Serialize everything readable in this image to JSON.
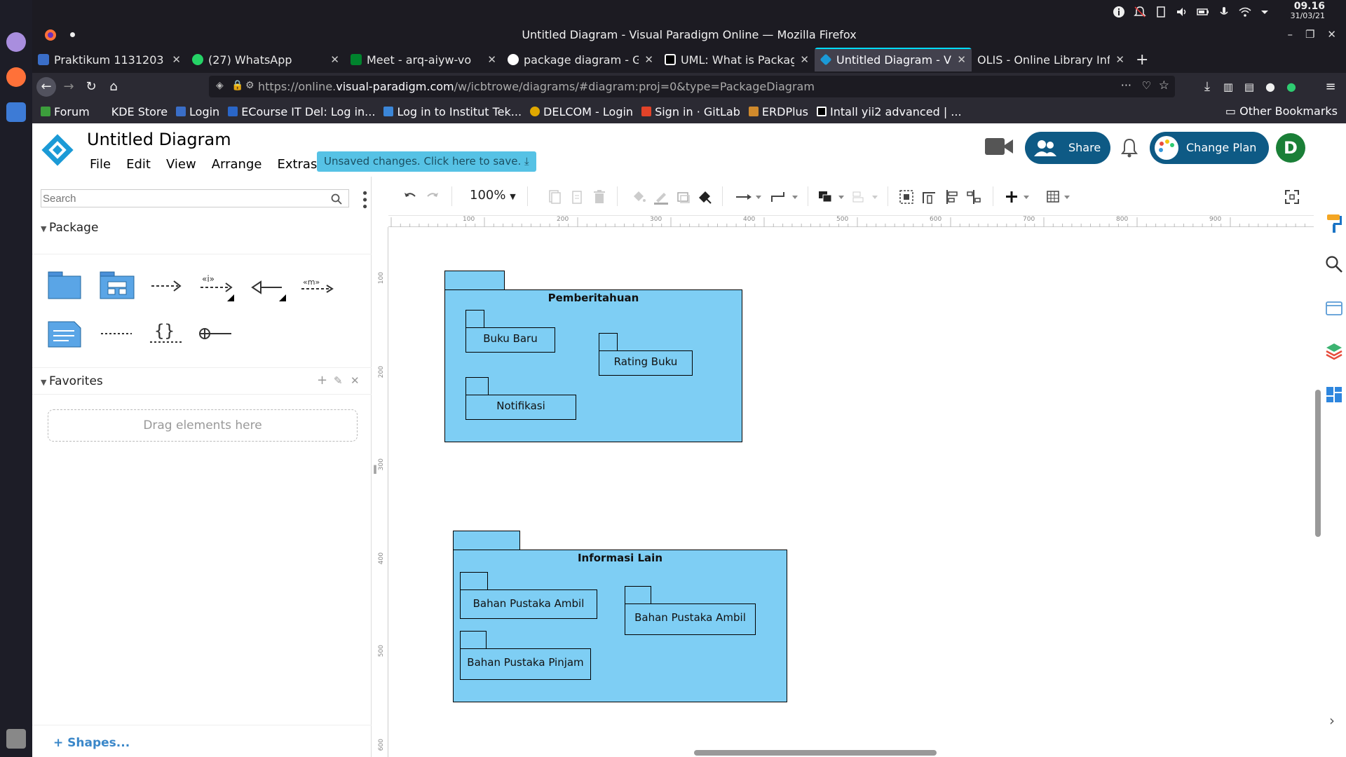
{
  "os": {
    "clock_time": "09.16",
    "clock_date": "31/03/21"
  },
  "window": {
    "title": "Untitled Diagram - Visual Paradigm Online — Mozilla Firefox"
  },
  "tabs": [
    {
      "label": "Praktikum 1131203",
      "active": false
    },
    {
      "label": "(27) WhatsApp",
      "active": false
    },
    {
      "label": "Meet - arq-aiyw-vo",
      "active": false
    },
    {
      "label": "package diagram - G",
      "active": false
    },
    {
      "label": "UML: What is Packag",
      "active": false
    },
    {
      "label": "Untitled Diagram - VP",
      "active": true
    },
    {
      "label": "OLIS - Online Library Inf",
      "active": false
    }
  ],
  "url": {
    "prefix": "https://online.",
    "domain": "visual-paradigm.com",
    "path": "/w/icbtrowe/diagrams/#diagram:proj=0&type=PackageDiagram"
  },
  "bookmarks": [
    "Forum",
    "KDE Store",
    "Login",
    "ECourse IT Del: Log in...",
    "Log in to Institut Tek...",
    "DELCOM - Login",
    "Sign in · GitLab",
    "ERDPlus",
    "Intall yii2 advanced | ..."
  ],
  "other_bookmarks": "Other Bookmarks",
  "app": {
    "title": "Untitled Diagram",
    "menu": [
      "File",
      "Edit",
      "View",
      "Arrange",
      "Extras"
    ],
    "unsaved": "Unsaved changes. Click here to save.",
    "share": "Share",
    "change_plan": "Change Plan",
    "avatar_letter": "D"
  },
  "sidebar": {
    "search_placeholder": "Search",
    "package_section": "Package",
    "favorites_section": "Favorites",
    "drag_hint": "Drag elements here",
    "shapes_link": "+ Shapes..."
  },
  "toolbar": {
    "zoom": "100%"
  },
  "ruler": {
    "top": [
      "100",
      "200",
      "300",
      "400",
      "500",
      "600",
      "700",
      "800",
      "900"
    ],
    "left": [
      "100",
      "200",
      "300",
      "400",
      "500",
      "600"
    ]
  },
  "diagram": {
    "packages": [
      {
        "name": "Pemberitahuan",
        "children": [
          "Buku Baru",
          "Rating Buku",
          "Notifikasi"
        ]
      },
      {
        "name": "Informasi Lain",
        "children": [
          "Bahan Pustaka Ambil",
          "Bahan Pustaka Ambil",
          "Bahan Pustaka Pinjam"
        ]
      }
    ],
    "fill_color": "#7ecef4",
    "stroke_color": "#000000"
  }
}
